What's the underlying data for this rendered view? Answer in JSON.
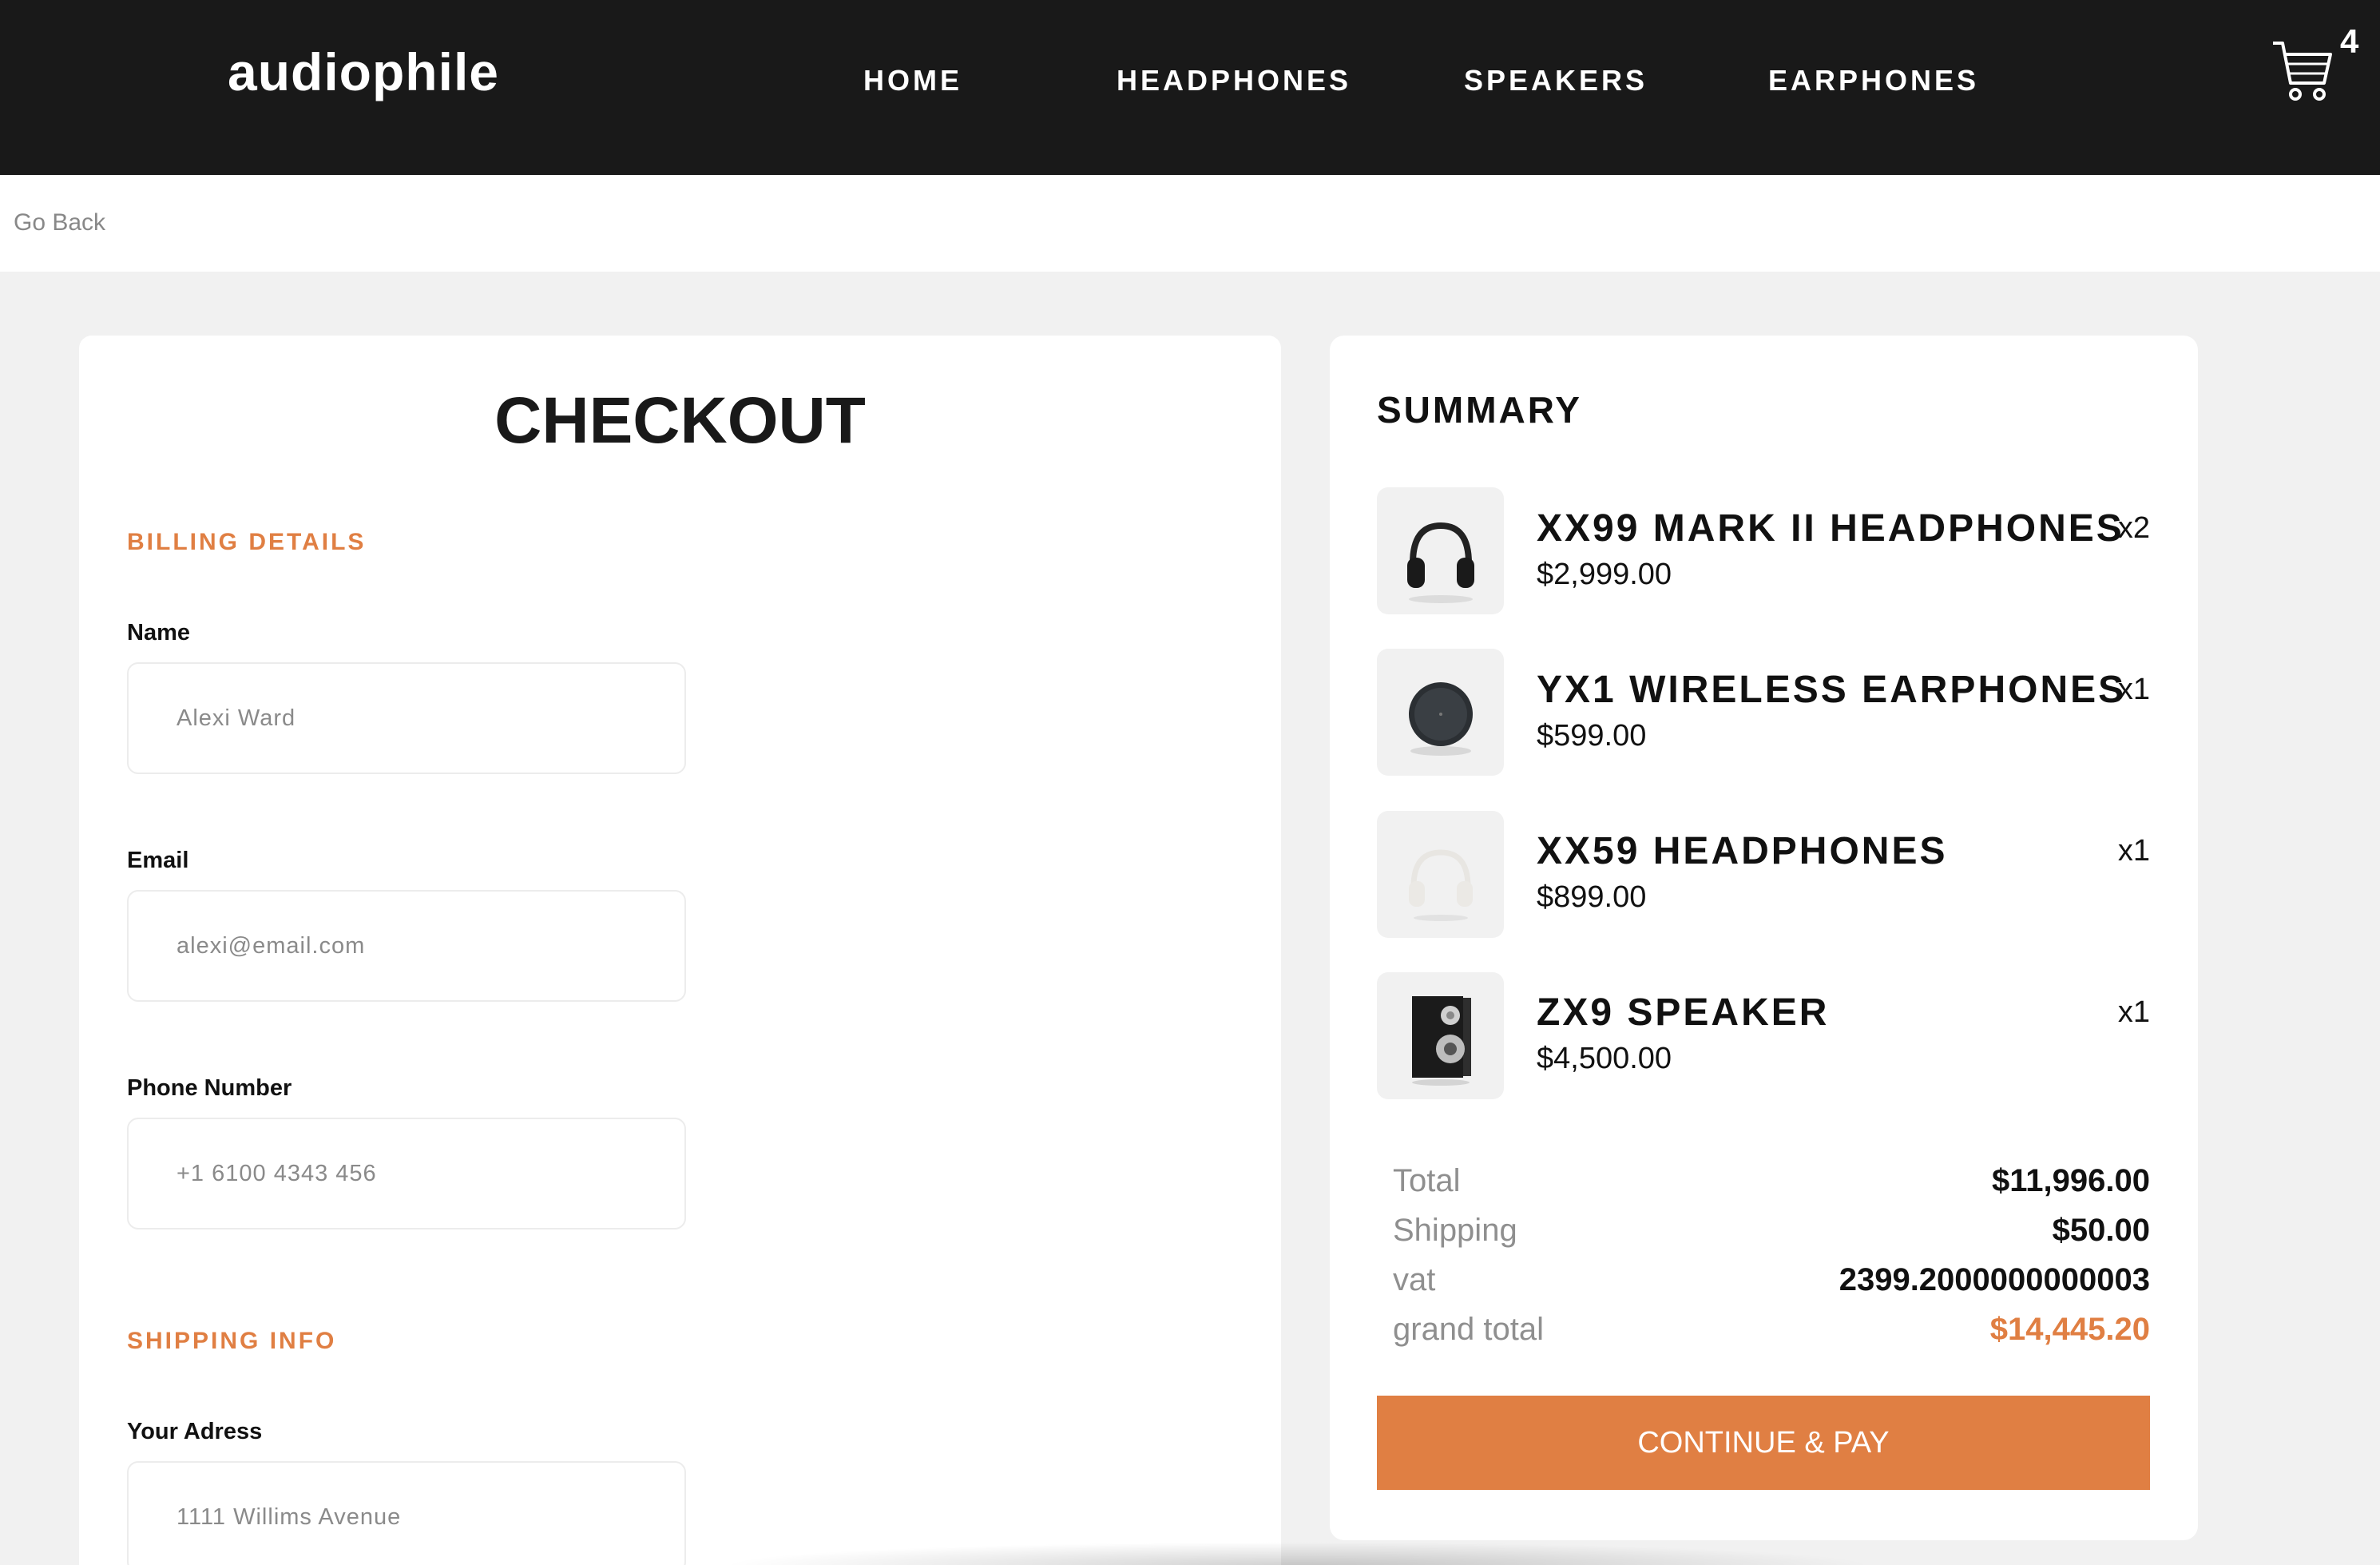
{
  "header": {
    "logo": "audiophile",
    "nav": [
      "HOME",
      "HEADPHONES",
      "SPEAKERS",
      "EARPHONES"
    ],
    "cart_count": "4",
    "cart_icon": "cart-icon"
  },
  "go_back": "Go Back",
  "checkout": {
    "title": "CHECKOUT",
    "billing_label": "BILLING DETAILS",
    "fields": {
      "name": {
        "label": "Name",
        "placeholder": "Alexi Ward"
      },
      "email": {
        "label": "Email",
        "placeholder": "alexi@email.com"
      },
      "phone": {
        "label": "Phone Number",
        "placeholder": "+1 6100 4343 456"
      },
      "address": {
        "label": "Your Adress",
        "placeholder": "1111 Willims Avenue"
      }
    },
    "shipping_label": "SHIPPING INFO"
  },
  "summary": {
    "title": "SUMMARY",
    "items": [
      {
        "name": "XX99 MARK II HEADPHONES",
        "price": "$2,999.00",
        "qty": "x2",
        "icon": "headphones-black-icon"
      },
      {
        "name": "YX1 WIRELESS EARPHONES",
        "price": "$599.00",
        "qty": "x1",
        "icon": "earphones-case-icon"
      },
      {
        "name": "XX59 HEADPHONES",
        "price": "$899.00",
        "qty": "x1",
        "icon": "headphones-white-icon"
      },
      {
        "name": "ZX9 SPEAKER",
        "price": "$4,500.00",
        "qty": "x1",
        "icon": "speaker-icon"
      }
    ],
    "totals": {
      "total_label": "Total",
      "total_value": "$11,996.00",
      "shipping_label": "Shipping",
      "shipping_value": "$50.00",
      "vat_label": "vat",
      "vat_value": "2399.2000000000003",
      "grand_label": "grand total",
      "grand_value": "$14,445.20"
    },
    "button": "CONTINUE & PAY"
  },
  "colors": {
    "accent": "#e07f43",
    "header_bg": "#191919",
    "page_bg": "#f1f1f1"
  }
}
